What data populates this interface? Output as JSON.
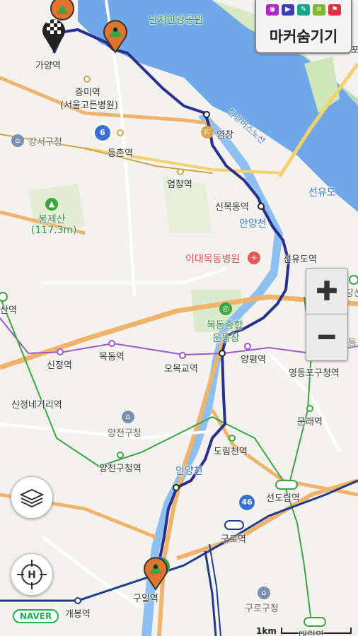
{
  "controls": {
    "hide_markers_label": "마커숨기기",
    "zoom_in": "✚",
    "zoom_out": "━",
    "naver_logo": "NAVER",
    "scale_label": "1km",
    "marker_icons": [
      "camera-icon",
      "video-icon",
      "pen-icon",
      "note-icon",
      "flag-icon"
    ],
    "layers_icon": "layers-icon",
    "location_icon": "hiking-locate-icon"
  },
  "labels": {
    "nanji": "난지한강공원",
    "mapo": "마포",
    "gayang": "가양역",
    "jeungmi": "증미역",
    "seoul_godeun": "(서울고든병원)",
    "gangseo_office": "강서구청",
    "deungchon": "등촌역",
    "yeomchang": "염창역",
    "yeomchang_jc": "염창",
    "jc": "JC",
    "bongjesan": "봉제산",
    "bongjesan_elev": "(117.3m)",
    "sinmokdong": "신목동역",
    "anyangcheon_top": "안양천",
    "seonyudo_area": "선유도",
    "seonyudo_station": "선유도역",
    "hangang_bus": "한강버스노선",
    "ewha_mokdong": "이대목동병원",
    "mokdong_stadium_1": "목동종합",
    "mokdong_stadium_2": "운동장",
    "yangpyeong": "양평역",
    "yeongdeungpo_office": "영등포구청역",
    "sinjeong": "신정역",
    "mokdong": "목동역",
    "omokgyo": "오목교역",
    "sinjeong_4": "신정네거리역",
    "yangcheon_office": "양천구청",
    "yangcheon_station": "양천구청역",
    "mullae": "문래역",
    "dorimcheon": "도림천역",
    "anyangcheon_bottom": "안양천",
    "route_46": "46",
    "route_6": "6",
    "sindorim": "선도림역",
    "guro": "구로역",
    "guro_office": "구로구청",
    "guil": "구일역",
    "gaebong": "개봉역",
    "daerim": "대림역",
    "yangcheon_left": "양천구",
    "san_station": "산역",
    "dangsan": "당산",
    "deungpo": "등포",
    "yeongdeungpo_small": "영등포"
  },
  "colors": {
    "route": "#2a2f8c",
    "river": "#6fa8e8",
    "riverbank": "#cfe6b8",
    "arterial": "#f0b36b",
    "line2": "#3aa543",
    "line5": "#9b59c9",
    "line1": "#1e3a8a",
    "park": "#d7ebc5"
  }
}
